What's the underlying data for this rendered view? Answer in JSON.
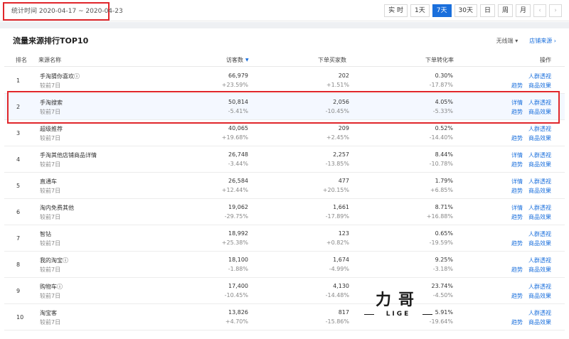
{
  "topbar": {
    "date_range": "统计时间 2020-04-17 ~ 2020-04-23",
    "periods": [
      {
        "label": "实 时",
        "active": false
      },
      {
        "label": "1天",
        "active": false
      },
      {
        "label": "7天",
        "active": true
      },
      {
        "label": "30天",
        "active": false
      },
      {
        "label": "日",
        "active": false
      },
      {
        "label": "周",
        "active": false
      },
      {
        "label": "月",
        "active": false
      },
      {
        "label": "‹",
        "active": false
      },
      {
        "label": "›",
        "active": false
      }
    ]
  },
  "panel": {
    "title": "流量来源排行TOP10",
    "wireless": "无线端 ▾",
    "shop_source": "店铺来源 ›"
  },
  "table": {
    "headers": {
      "rank": "排名",
      "source": "来源名称",
      "visitors": "访客数",
      "buyers": "下单买家数",
      "rate": "下单转化率",
      "ops": "操作"
    },
    "compare_label": "较前7日",
    "ops": {
      "detail": "详情",
      "crowd": "人群透视",
      "trend": "趋势",
      "goods": "商品效果"
    },
    "rows": [
      {
        "rank": "1",
        "name": "手淘猜你喜欢ⓘ",
        "visitors": "66,979",
        "visitors_delta": "+23.59%",
        "buyers": "202",
        "buyers_delta": "+1.51%",
        "rate": "0.30%",
        "rate_delta": "-17.87%",
        "has_detail": false
      },
      {
        "rank": "2",
        "name": "手淘搜索",
        "visitors": "50,814",
        "visitors_delta": "-5.41%",
        "buyers": "2,056",
        "buyers_delta": "-10.45%",
        "rate": "4.05%",
        "rate_delta": "-5.33%",
        "has_detail": true
      },
      {
        "rank": "3",
        "name": "超级推荐",
        "visitors": "40,065",
        "visitors_delta": "+19.68%",
        "buyers": "209",
        "buyers_delta": "+2.45%",
        "rate": "0.52%",
        "rate_delta": "-14.40%",
        "has_detail": false
      },
      {
        "rank": "4",
        "name": "手淘其他店铺商品详情",
        "visitors": "26,748",
        "visitors_delta": "-3.44%",
        "buyers": "2,257",
        "buyers_delta": "-13.85%",
        "rate": "8.44%",
        "rate_delta": "-10.78%",
        "has_detail": true
      },
      {
        "rank": "5",
        "name": "直通车",
        "visitors": "26,584",
        "visitors_delta": "+12.44%",
        "buyers": "477",
        "buyers_delta": "+20.15%",
        "rate": "1.79%",
        "rate_delta": "+6.85%",
        "has_detail": true
      },
      {
        "rank": "6",
        "name": "淘内免费其他",
        "visitors": "19,062",
        "visitors_delta": "-29.75%",
        "buyers": "1,661",
        "buyers_delta": "-17.89%",
        "rate": "8.71%",
        "rate_delta": "+16.88%",
        "has_detail": true
      },
      {
        "rank": "7",
        "name": "智钻",
        "visitors": "18,992",
        "visitors_delta": "+25.38%",
        "buyers": "123",
        "buyers_delta": "+0.82%",
        "rate": "0.65%",
        "rate_delta": "-19.59%",
        "has_detail": false
      },
      {
        "rank": "8",
        "name": "我的淘宝ⓘ",
        "visitors": "18,100",
        "visitors_delta": "-1.88%",
        "buyers": "1,674",
        "buyers_delta": "-4.99%",
        "rate": "9.25%",
        "rate_delta": "-3.18%",
        "has_detail": false
      },
      {
        "rank": "9",
        "name": "购物车ⓘ",
        "visitors": "17,400",
        "visitors_delta": "-10.45%",
        "buyers": "4,130",
        "buyers_delta": "-14.48%",
        "rate": "23.74%",
        "rate_delta": "-4.50%",
        "has_detail": false
      },
      {
        "rank": "10",
        "name": "淘宝客",
        "visitors": "13,826",
        "visitors_delta": "+4.70%",
        "buyers": "817",
        "buyers_delta": "-15.86%",
        "rate": "5.91%",
        "rate_delta": "-19.64%",
        "has_detail": false
      }
    ]
  },
  "watermark": {
    "top": "力哥",
    "bottom": "LIGE"
  }
}
